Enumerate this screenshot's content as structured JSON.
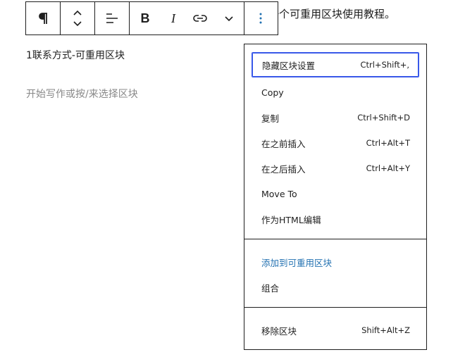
{
  "editor": {
    "paragraph_text": "享一个可重用区块使用教程。",
    "block_title": "1联系方式-可重用区块",
    "placeholder": "开始写作或按/来选择区块"
  },
  "toolbar": {
    "buttons": [
      {
        "name": "paragraph-icon"
      },
      {
        "name": "move-up-down-icon"
      },
      {
        "name": "align-left-icon"
      },
      {
        "name": "bold-icon",
        "label": "B"
      },
      {
        "name": "italic-icon",
        "label": "I"
      },
      {
        "name": "link-icon"
      },
      {
        "name": "chevron-down-icon"
      },
      {
        "name": "more-options-icon"
      }
    ]
  },
  "menu": {
    "items": [
      {
        "label": "隐藏区块设置",
        "shortcut": "Ctrl+Shift+,"
      },
      {
        "label": "Copy",
        "shortcut": ""
      },
      {
        "label": "复制",
        "shortcut": "Ctrl+Shift+D"
      },
      {
        "label": "在之前插入",
        "shortcut": "Ctrl+Alt+T"
      },
      {
        "label": "在之后插入",
        "shortcut": "Ctrl+Alt+Y"
      },
      {
        "label": "Move To",
        "shortcut": ""
      },
      {
        "label": "作为HTML编辑",
        "shortcut": ""
      },
      {
        "label": "添加到可重用区块",
        "shortcut": ""
      },
      {
        "label": "组合",
        "shortcut": ""
      },
      {
        "label": "移除区块",
        "shortcut": "Shift+Alt+Z"
      }
    ]
  },
  "colors": {
    "accent": "#2271b1",
    "focus": "#3858e9",
    "border": "#1e1e1e",
    "placeholder": "#888888"
  }
}
